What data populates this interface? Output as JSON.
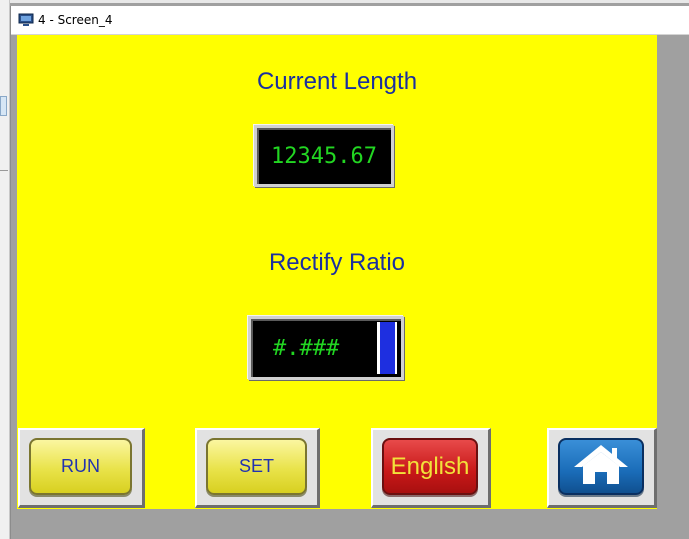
{
  "window": {
    "title": "4 - Screen_4",
    "icon": "monitor-icon"
  },
  "screen": {
    "background": "#ffff00",
    "current_length": {
      "label": "Current Length",
      "value": "12345.67"
    },
    "rectify_ratio": {
      "label": "Rectify Ratio",
      "value": "#.###"
    },
    "buttons": {
      "run": "RUN",
      "set": "SET",
      "language": "English",
      "home_icon": "home-icon"
    }
  },
  "colors": {
    "label_text": "#1a2fa0",
    "display_text": "#22d622",
    "run_set_button": "#e9e34a",
    "english_button": "#c81818",
    "home_button": "#1a6cb8"
  }
}
